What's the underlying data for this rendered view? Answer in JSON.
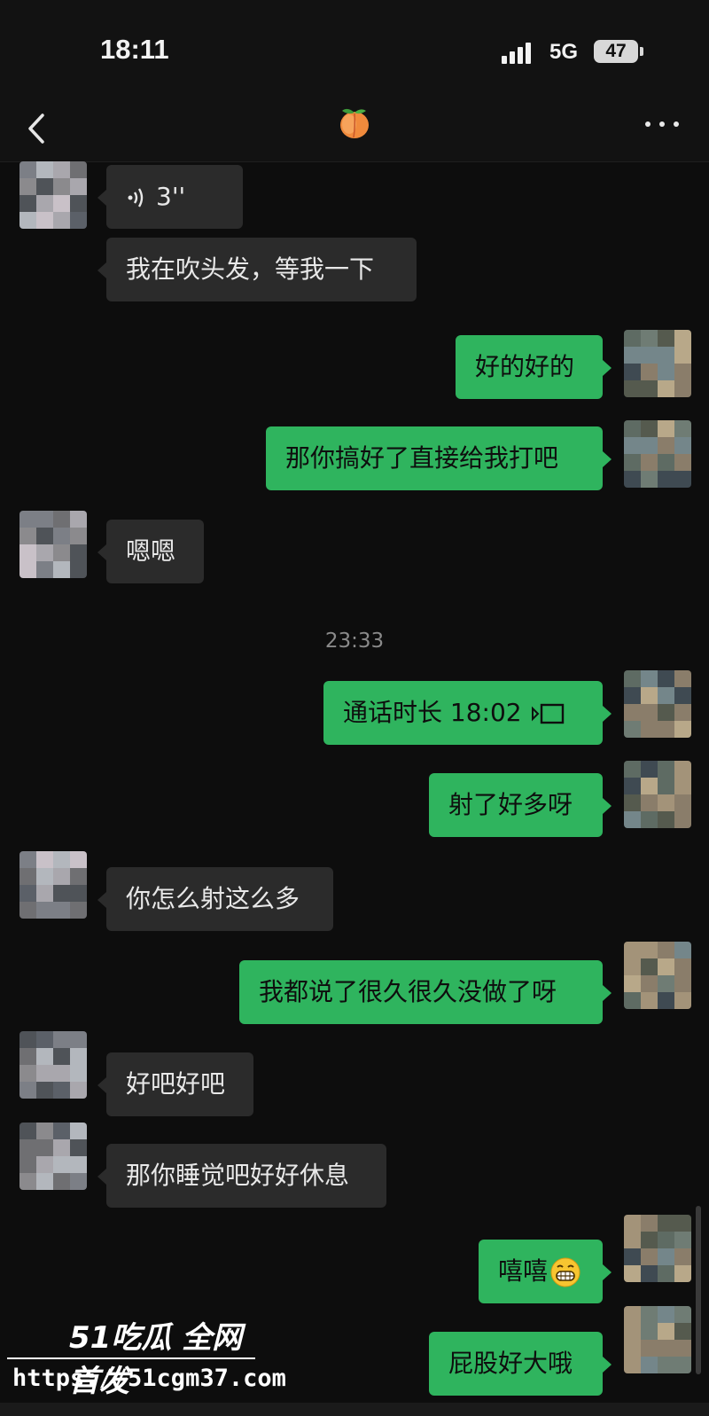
{
  "status_bar": {
    "time": "18:11",
    "network": "5G",
    "battery": "47"
  },
  "nav": {
    "title_icon": "peach-emoji",
    "back_icon": "chevron-left-icon",
    "more_icon": "more-dots-icon"
  },
  "messages": [
    {
      "side": "in",
      "type": "voice",
      "text": "3''"
    },
    {
      "side": "in",
      "text": "我在吹头发，等我一下"
    },
    {
      "side": "out",
      "text": "好的好的"
    },
    {
      "side": "out",
      "text": "那你搞好了直接给我打吧"
    },
    {
      "side": "in",
      "text": "嗯嗯"
    },
    {
      "side": "out",
      "type": "call",
      "text": "通话时长 18:02"
    },
    {
      "side": "out",
      "text": "射了好多呀"
    },
    {
      "side": "in",
      "text": "你怎么射这么多"
    },
    {
      "side": "out",
      "text": "我都说了很久很久没做了呀"
    },
    {
      "side": "in",
      "text": "好吧好吧"
    },
    {
      "side": "in",
      "text": "那你睡觉吧好好休息"
    },
    {
      "side": "out",
      "text": "嘻嘻",
      "emoji": "grinning-face"
    },
    {
      "side": "out",
      "text": "屁股好大哦"
    }
  ],
  "timestamp": "23:33",
  "watermark": {
    "brand": "51吃瓜 全网首发",
    "url": "https://51cgm37.com"
  },
  "colors": {
    "outgoing": "#2fb45e",
    "incoming": "#2b2b2b",
    "background": "#0d0d0d"
  }
}
